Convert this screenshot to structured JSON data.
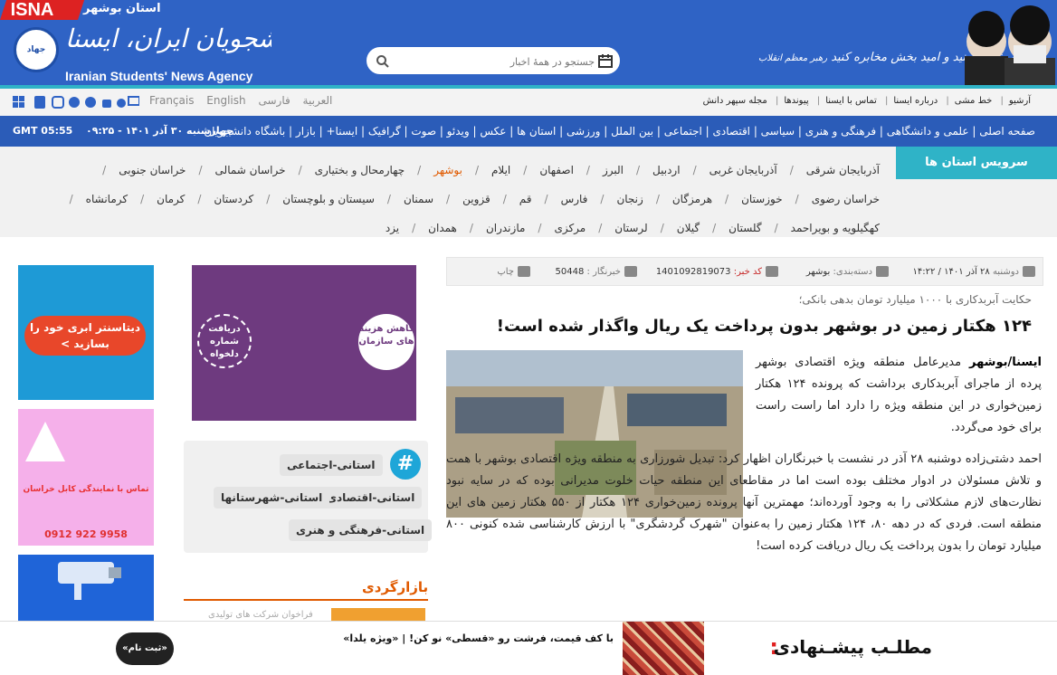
{
  "header": {
    "isna_badge": "ISNA",
    "province": "استان بوشهر",
    "logo_fa": "خبرگزاری دانشجویان ایران، ایسنا",
    "logo_en": "Iranian Students' News Agency",
    "logo_badge": "جهاد",
    "search_placeholder": "جستجو در همهٔ اخبار",
    "slogan": "اخبار خوب، منید و امید بخش مخابره کنید",
    "slogan_sub": "رهبر معظم انقلاب"
  },
  "topnav": {
    "links": [
      "آرشیو",
      "خط مشی",
      "درباره ایسنا",
      "تماس با ایسنا",
      "پیوندها",
      "مجله سپهر دانش"
    ],
    "languages": [
      "فارسی",
      "العربية",
      "English",
      "Français"
    ]
  },
  "mainnav": {
    "items": "صفحه اصلی | علمی و دانشگاهی | فرهنگی و هنری | سیاسی | اقتصادی | اجتماعی | بین الملل | ورزشی | استان ها | عکس | ویدئو | صوت | گرافیک | ایسنا+ | بازار | باشگاه دانشجویان",
    "date": "چهارشنبه ۳۰ آذر ۱۴۰۱ - ۰۹:۲۵",
    "time": "GMT 05:55"
  },
  "provinces": {
    "title": "سرویس استان ها",
    "list": [
      "آذربایجان شرقی",
      "آذربایجان غربی",
      "اردبیل",
      "البرز",
      "اصفهان",
      "ایلام",
      "بوشهر",
      "چهارمحال و بختیاری",
      "خراسان شمالی",
      "خراسان جنوبی",
      "خراسان رضوی",
      "خوزستان",
      "هرمزگان",
      "زنجان",
      "فارس",
      "قم",
      "قزوین",
      "سمنان",
      "سیستان و بلوچستان",
      "کردستان",
      "کرمان",
      "کرمانشاه",
      "کهگیلویه و بویراحمد",
      "گلستان",
      "گیلان",
      "لرستان",
      "مرکزی",
      "مازندران",
      "همدان",
      "یزد"
    ],
    "active": "بوشهر"
  },
  "ads": {
    "ad1_text": "دیتاسنتر ابری خود را",
    "ad1_cta": "بسازید",
    "ad2_text": "تماس با نمایندگی کابل خراسان",
    "ad2_phone": "0912 922 9958",
    "side_small": "دریافت شماره دلخواه",
    "side_large": "کاهش هزینه های سازمان"
  },
  "tags": [
    "استانی-اجتماعی",
    "استانی-اقتصادی",
    "استانی-شهرستانها",
    "استانی-فرهنگی و هنری"
  ],
  "bazar": {
    "title": "بازارگردی",
    "item": "فراخوان شرکت های تولیدی"
  },
  "article": {
    "meta": {
      "day": "دوشنبه",
      "date": "۲۸ آذر ۱۴۰۱ / ۱۴:۲۲",
      "category_label": "دسته‌بندی:",
      "category": "بوشهر",
      "code_label": "کد خبر:",
      "code": "1401092819073",
      "reporter_label": "خبرنگار :",
      "reporter": "50448",
      "print": "چاپ"
    },
    "lead": "حکایت آبربدکاری با ۱۰۰۰ میلیارد تومان بدهی بانکی؛",
    "headline": "۱۲۴ هکتار زمین در بوشهر بدون پرداخت یک ریال واگذار شده است!",
    "source": "ایسنا/بوشهر",
    "para1": "مدیرعامل منطقه ویژه اقتصادی بوشهر پرده از ماجرای آبربدکاری برداشت که پرونده ۱۲۴ هکتار زمین‌خواری در این منطقه ویژه را دارد اما راست راست برای خود می‌گردد.",
    "para2": "احمد دشتی‌زاده دوشنبه ۲۸ آذر در نشست با خبرنگاران اظهار کرد: تبدیل شورزاری به منطقه ویژه اقتصادی بوشهر با همت و تلاش مسئولان در ادوار مختلف بوده است اما در مقاطعای این منطقه حیات خلوت مدیرانی بوده که در سایه نبود نظارت‌های لازم مشکلاتی را به وجود آورده‌اند؛ مهمترین آنها پرونده زمین‌خواری ۱۲۴ هکتار از ۵۵۰ هکتار زمین های این منطقه است. فردی که در دهه ۸۰، ۱۲۴ هکتار زمین را به‌عنوان \"شهرک گردشگری\" با ارزش کارشناسی شده کنونی ۸۰۰ میلیارد تومان را بدون پرداخت یک ریال دریافت کرده است!"
  },
  "bottom": {
    "title": "مطلـب پیشـنهادی",
    "colon": ":",
    "text": "با کف قیمت، فرشت رو «قسطی» نو کن! | «ویژه یلدا»",
    "register": "«ثبت نام»"
  }
}
